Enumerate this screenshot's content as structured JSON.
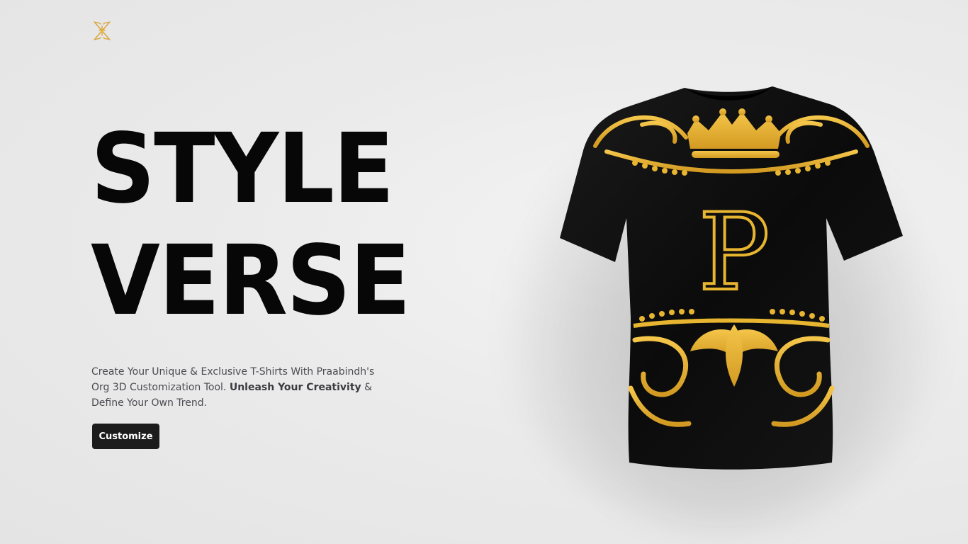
{
  "brand": {
    "logo_icon": "ornate-monogram-logo",
    "accent_color": "#e7b52f"
  },
  "hero": {
    "title_line1": "STYLE",
    "title_line2": "VERSE",
    "tagline_part1": "Create Your Unique & Exclusive T-Shirts With Praabindh's Org 3D Customization Tool.",
    "tagline_bold": "Unleash Your Creativity",
    "tagline_part2": "& Define Your Own Trend.",
    "cta_label": "Customize"
  },
  "showcase": {
    "monogram": "P",
    "shirt_color": "#0e0e0e"
  }
}
